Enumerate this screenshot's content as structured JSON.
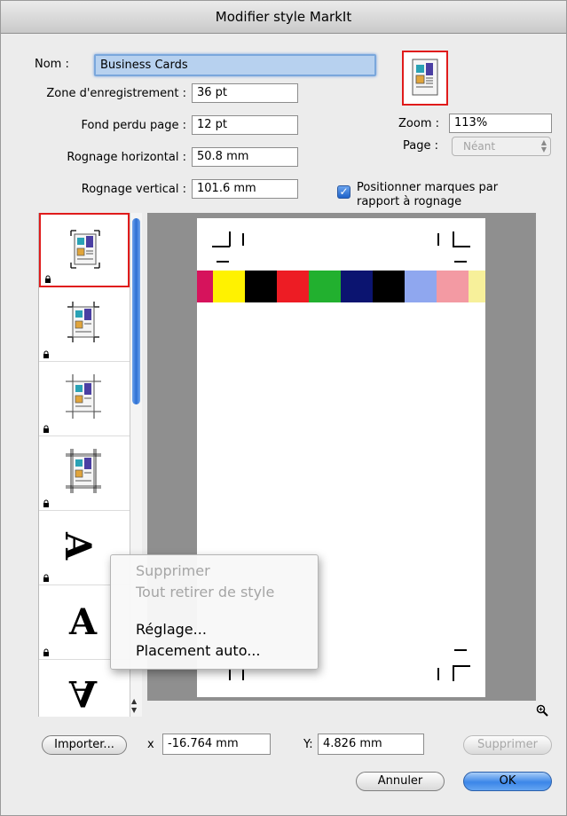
{
  "window": {
    "title": "Modifier style MarkIt"
  },
  "form": {
    "name_label": "Nom :",
    "name_value": "Business Cards",
    "zone_label": "Zone d'enregistrement :",
    "zone_value": "36 pt",
    "fond_label": "Fond perdu page :",
    "fond_value": "12 pt",
    "rognage_h_label": "Rognage horizontal :",
    "rognage_h_value": "50.8 mm",
    "rognage_v_label": "Rognage vertical :",
    "rognage_v_value": "101.6 mm"
  },
  "right_panel": {
    "zoom_label": "Zoom :",
    "zoom_value": "113%",
    "page_label": "Page :",
    "page_value": "Néant",
    "checkbox_label_line1": "Positionner marques par",
    "checkbox_label_line2": "rapport à rognage",
    "checkbox_checked": true
  },
  "thumbnails": [
    {
      "icon": "layout-thumb-1",
      "selected": true
    },
    {
      "icon": "layout-thumb-2",
      "selected": false
    },
    {
      "icon": "layout-thumb-3",
      "selected": false
    },
    {
      "icon": "layout-thumb-4",
      "selected": false
    },
    {
      "icon": "letter-a-rotated",
      "glyph": "A",
      "selected": false
    },
    {
      "icon": "letter-a",
      "glyph": "A",
      "selected": false
    },
    {
      "icon": "letter-a-flipped",
      "glyph": "A",
      "selected": false
    }
  ],
  "colorbar": [
    "#d6135c",
    "#fff200",
    "#000000",
    "#ed1c24",
    "#22b02f",
    "#0b1470",
    "#000000",
    "#8fa7ef",
    "#f39aa3",
    "#f7f09a"
  ],
  "context_menu": {
    "items": [
      {
        "label": "Supprimer",
        "enabled": false
      },
      {
        "label": "Tout retirer de style",
        "enabled": false
      },
      {
        "label": "Réglage...",
        "enabled": true
      },
      {
        "label": "Placement auto...",
        "enabled": true
      }
    ]
  },
  "bottom": {
    "import_button": "Importer...",
    "x_label": "x",
    "x_value": "-16.764 mm",
    "y_label": "Y:",
    "y_value": "4.826 mm",
    "delete_button": "Supprimer",
    "cancel_button": "Annuler",
    "ok_button": "OK"
  }
}
